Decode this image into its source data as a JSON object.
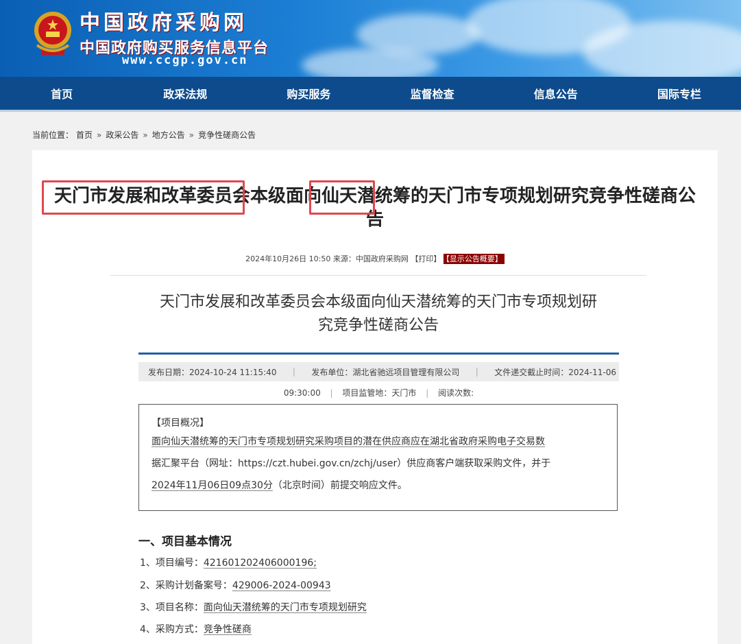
{
  "header": {
    "site_name": "中国政府采购网",
    "site_sub": "中国政府购买服务信息平台",
    "site_url": "www.ccgp.gov.cn"
  },
  "nav": [
    "首页",
    "政采法规",
    "购买服务",
    "监督检查",
    "信息公告",
    "国际专栏"
  ],
  "breadcrumb": {
    "prefix": "当前位置：",
    "items": [
      "首页",
      "政采公告",
      "地方公告",
      "竞争性磋商公告"
    ],
    "separator": "»"
  },
  "article": {
    "title_part1": "天门市发展和改革委员会",
    "title_part2": "本级面向",
    "title_part3": "仙天潜",
    "title_part4": "统筹的天门市专项规划研究竞争性磋商公",
    "title_part5": "告",
    "meta_text": "2024年10月26日 10:50 来源：中国政府采购网 【打印】",
    "meta_badge": "【显示公告概要】",
    "sub_title_line1": "天门市发展和改革委员会本级面向仙天潜统筹的天门市专项规划研",
    "sub_title_line2": "究竞争性磋商公告",
    "publish_date": "发布日期：2024-10-24 11:15:40",
    "publisher": "发布单位：湖北省驰远项目管理有限公司",
    "deadline": "文件递交截止时间：2024-11-06",
    "deadline_time": "09:30:00",
    "supervision": "项目监管地：天门市",
    "reads": "阅读次数:",
    "overview_head": "【项目概况】",
    "overview_l1": "面向仙天潜统筹的天门市专项规划研究采购项目的潜在供应商应在湖北省政府采购电子交易数",
    "overview_l2": "据汇聚平台（网址：https://czt.hubei.gov.cn/zchj/user）供应商客户端获取采购文件，并于",
    "overview_l3a": "2024年11月06日09点30分",
    "overview_l3b": "（北京时间）前提交响应文件。",
    "section1": "一、项目基本情况",
    "items": [
      {
        "label": "1、项目编号：",
        "value": "421601202406000196;"
      },
      {
        "label": "2、采购计划备案号：",
        "value": "429006-2024-00943"
      },
      {
        "label": "3、项目名称：",
        "value": "面向仙天潜统筹的天门市专项规划研究"
      },
      {
        "label": "4、采购方式：",
        "value": "竞争性磋商"
      }
    ]
  },
  "colors": {
    "nav_bg": "#0d4b8c",
    "highlight": "#e0474c",
    "badge_bg": "#8b0000",
    "accent_line": "#1e5fa8"
  }
}
